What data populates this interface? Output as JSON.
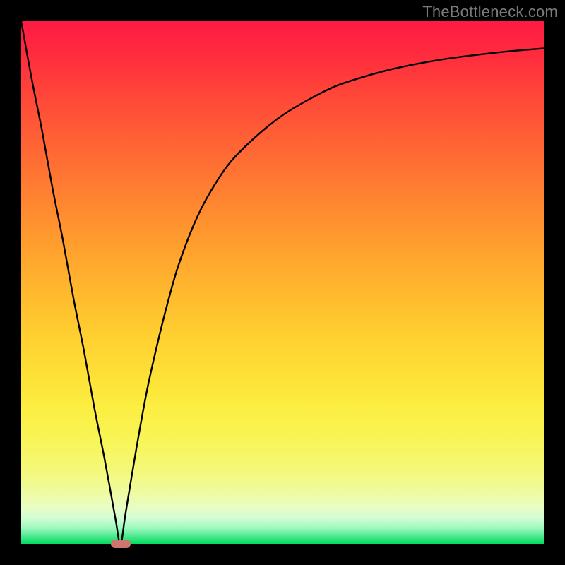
{
  "watermark": "TheBottleneck.com",
  "chart_data": {
    "type": "line",
    "title": "",
    "xlabel": "",
    "ylabel": "",
    "xlim": [
      0,
      100
    ],
    "ylim": [
      0,
      100
    ],
    "grid": false,
    "series": [
      {
        "name": "bottleneck-curve",
        "x": [
          0,
          2,
          4,
          6,
          8,
          10,
          12,
          14,
          16,
          18,
          19,
          20,
          22,
          24,
          26,
          28,
          30,
          33,
          36,
          40,
          45,
          50,
          55,
          60,
          65,
          70,
          75,
          80,
          85,
          90,
          95,
          100
        ],
        "values": [
          100,
          89,
          79,
          68,
          58,
          47,
          37,
          26,
          16,
          5,
          0,
          6,
          18,
          29,
          38,
          46,
          53,
          61,
          67,
          73,
          78,
          82,
          85,
          87.5,
          89.2,
          90.6,
          91.7,
          92.6,
          93.3,
          93.9,
          94.4,
          94.8
        ]
      }
    ],
    "marker": {
      "name": "optimal-point",
      "x": 19,
      "y": 0,
      "color": "#cf7471"
    },
    "background_gradient": {
      "top": "#ff1a44",
      "bottom": "#00db62"
    }
  }
}
